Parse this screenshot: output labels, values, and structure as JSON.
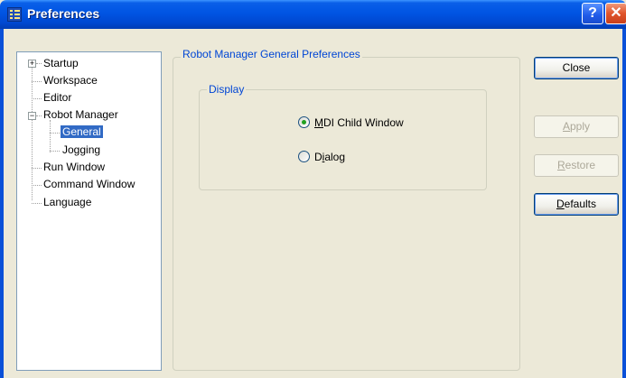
{
  "window": {
    "title": "Preferences",
    "help_glyph": "?",
    "close_glyph": "✕",
    "icon": "app-menu-icon"
  },
  "tree": {
    "items": [
      {
        "label": "Startup",
        "expander": "+"
      },
      {
        "label": "Workspace"
      },
      {
        "label": "Editor"
      },
      {
        "label": "Robot Manager",
        "expander": "−"
      },
      {
        "label": "General",
        "selected": true
      },
      {
        "label": "Jogging"
      },
      {
        "label": "Run Window"
      },
      {
        "label": "Command Window"
      },
      {
        "label": "Language"
      }
    ]
  },
  "panel": {
    "title": "Robot Manager General Preferences",
    "display": {
      "title": "Display",
      "options": [
        {
          "label_pre": "",
          "mnemonic": "M",
          "label_post": "DI Child Window",
          "selected": true
        },
        {
          "label_pre": "D",
          "mnemonic": "i",
          "label_post": "alog",
          "selected": false
        }
      ]
    }
  },
  "buttons": {
    "close": {
      "label": "Close"
    },
    "apply": {
      "label_mnemonic": "A",
      "label_rest": "pply",
      "enabled": false
    },
    "restore": {
      "label_mnemonic": "R",
      "label_rest": "estore",
      "enabled": false
    },
    "defaults": {
      "label_mnemonic": "D",
      "label_rest": "efaults",
      "enabled": true
    }
  },
  "colors": {
    "titlebar": "#0054e3",
    "selection": "#316ac5",
    "group_title": "#0046d5",
    "radio_dot": "#21a121"
  }
}
